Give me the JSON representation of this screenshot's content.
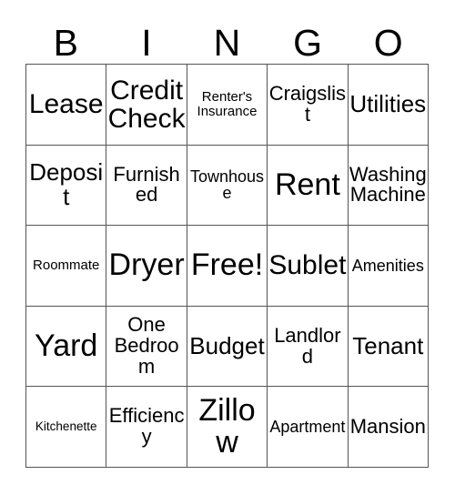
{
  "card": {
    "title": "Bingo Card",
    "header_letters": [
      "B",
      "I",
      "N",
      "G",
      "O"
    ],
    "grid_size": "5x5",
    "colors": {
      "background": "#ffffff",
      "text": "#000000",
      "grid_line": "#555555"
    },
    "cells": [
      {
        "label": "Lease",
        "size": "xl",
        "column": "B",
        "row": 1,
        "free": false
      },
      {
        "label": "Credit Check",
        "size": "xl",
        "column": "I",
        "row": 1,
        "free": false
      },
      {
        "label": "Renter's Insurance",
        "size": "xs",
        "column": "N",
        "row": 1,
        "free": false
      },
      {
        "label": "Craigslist",
        "size": "m",
        "column": "G",
        "row": 1,
        "free": false
      },
      {
        "label": "Utilities",
        "size": "l",
        "column": "O",
        "row": 1,
        "free": false
      },
      {
        "label": "Deposit",
        "size": "l",
        "column": "B",
        "row": 2,
        "free": false
      },
      {
        "label": "Furnished",
        "size": "m",
        "column": "I",
        "row": 2,
        "free": false
      },
      {
        "label": "Townhouse",
        "size": "s",
        "column": "N",
        "row": 2,
        "free": false
      },
      {
        "label": "Rent",
        "size": "xxl",
        "column": "G",
        "row": 2,
        "free": false
      },
      {
        "label": "Washing Machine",
        "size": "m",
        "column": "O",
        "row": 2,
        "free": false
      },
      {
        "label": "Roommate",
        "size": "xs",
        "column": "B",
        "row": 3,
        "free": false
      },
      {
        "label": "Dryer",
        "size": "xxl",
        "column": "I",
        "row": 3,
        "free": false
      },
      {
        "label": "Free!",
        "size": "xxl",
        "column": "N",
        "row": 3,
        "free": true
      },
      {
        "label": "Sublet",
        "size": "xl",
        "column": "G",
        "row": 3,
        "free": false
      },
      {
        "label": "Amenities",
        "size": "s",
        "column": "O",
        "row": 3,
        "free": false
      },
      {
        "label": "Yard",
        "size": "xxl",
        "column": "B",
        "row": 4,
        "free": false
      },
      {
        "label": "One Bedroom",
        "size": "m",
        "column": "I",
        "row": 4,
        "free": false
      },
      {
        "label": "Budget",
        "size": "l",
        "column": "N",
        "row": 4,
        "free": false
      },
      {
        "label": "Landlord",
        "size": "m",
        "column": "G",
        "row": 4,
        "free": false
      },
      {
        "label": "Tenant",
        "size": "l",
        "column": "O",
        "row": 4,
        "free": false
      },
      {
        "label": "Kitchenette",
        "size": "xxs",
        "column": "B",
        "row": 5,
        "free": false
      },
      {
        "label": "Efficiency",
        "size": "m",
        "column": "I",
        "row": 5,
        "free": false
      },
      {
        "label": "Zillow",
        "size": "xxl",
        "column": "N",
        "row": 5,
        "free": false
      },
      {
        "label": "Apartment",
        "size": "s",
        "column": "G",
        "row": 5,
        "free": false
      },
      {
        "label": "Mansion",
        "size": "m",
        "column": "O",
        "row": 5,
        "free": false
      }
    ]
  }
}
